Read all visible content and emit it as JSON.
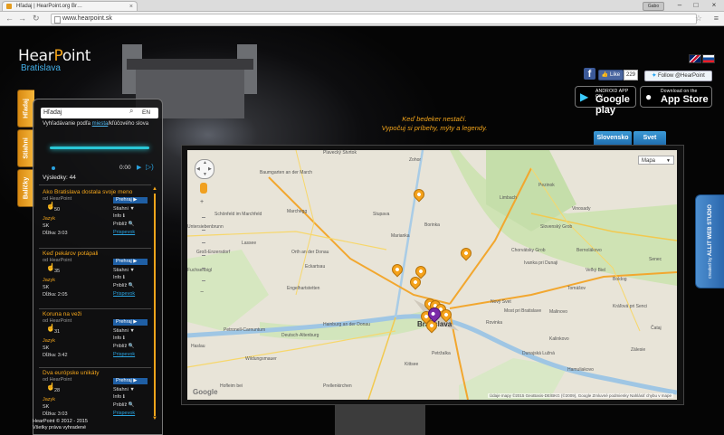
{
  "browser": {
    "tab_title": "Hľadaj | HearPoint.org Br…",
    "tab_close": "×",
    "url": "www.hearpoint.sk",
    "user_badge": "Gabo",
    "back_icon": "arrow-left-icon",
    "forward_icon": "arrow-right-icon",
    "reload_icon": "reload-icon",
    "minimize": "–",
    "maximize": "□",
    "close": "×",
    "star": "☆",
    "menu": "≡"
  },
  "brand": {
    "logo_a": "Hear",
    "logo_b": "P",
    "logo_c": "oint",
    "subtitle": "Bratislava"
  },
  "flags": [
    "en-flag-icon",
    "sk-flag-icon"
  ],
  "social": {
    "fb_icon": "f",
    "like_label": "👍 Like",
    "like_count": "229",
    "twitter_label": "Follow @HearPoint"
  },
  "stores": {
    "google_small": "ANDROID APP ON",
    "google_big": "Google play",
    "google_icon": "▶",
    "apple_small": "Download on the",
    "apple_big": "App Store",
    "apple_icon": ""
  },
  "tagline": {
    "line1": "Keď bedeker nestačí.",
    "line2": "Vypočuj si príbehy, mýty a legendy."
  },
  "map_tabs": [
    "Slovensko",
    "Svet"
  ],
  "side_tabs": [
    "Hľadaj",
    "Stiahni",
    "Balíčky"
  ],
  "panel": {
    "search_value": "Hľadaj",
    "search_icon": "⌕",
    "lang": "EN",
    "hint_pre": "Vyhľadávanie podľa ",
    "hint_link": "miesta",
    "hint_post": "/kľúčového slova",
    "player_time": "0:00",
    "play_icon": "▶",
    "volume_icon": "🔊",
    "results": "Výsledky: 44",
    "scroll_up": "▲",
    "scroll_down": "▼",
    "items": [
      {
        "title": "Ako Bratislava dostala svoje meno",
        "from": "od HearPoint",
        "count": "50",
        "l1": "Jazyk",
        "l2": "SK",
        "l3": "Dĺžka: 3:03",
        "play": "Prehraj ▶",
        "r1": "Stiahni ▼",
        "r2": "Info ℹ",
        "r3": "Priblíž 🔍",
        "r4": "Prispevok"
      },
      {
        "title": "Keď pekárov potápali",
        "from": "od HearPoint",
        "count": "35",
        "l1": "Jazyk",
        "l2": "SK",
        "l3": "Dĺžka: 2:05",
        "play": "Prehraj ▶",
        "r1": "Stiahni ▼",
        "r2": "Info ℹ",
        "r3": "Priblíž 🔍",
        "r4": "Prispevok"
      },
      {
        "title": "Koruna na veži",
        "from": "od HearPoint",
        "count": "31",
        "l1": "Jazyk",
        "l2": "SK",
        "l3": "Dĺžka: 3:42",
        "play": "Prehraj ▶",
        "r1": "Stiahni ▼",
        "r2": "Info ℹ",
        "r3": "Priblíž 🔍",
        "r4": "Prispevok"
      },
      {
        "title": "Dva európske unikáty",
        "from": "od HearPoint",
        "count": "28",
        "l1": "Jazyk",
        "l2": "SK",
        "l3": "Dĺžka: 3:03",
        "play": "Prehraj ▶",
        "r1": "Stiahni ▼",
        "r2": "Info ℹ",
        "r3": "Priblíž 🔍",
        "r4": "Prispevok"
      }
    ]
  },
  "copyright": {
    "line1": "HearPoint © 2012 - 2015",
    "line2": "Všetky práva vyhradené"
  },
  "map": {
    "type_select": "Mapa",
    "type_arrow": "▼",
    "google": "Google",
    "attribution": "Údaje mapy ©2015 GeoBasis-DE/BKG (©2009), Google  Zmluvné podmienky  Nahlásiť chybu v mape",
    "zoom_in": "+",
    "zoom_out": "−",
    "city": "Bratislava",
    "labels": [
      "Zohor",
      "Plavecký Štvrtok",
      "Stupava",
      "Borinka",
      "Marianka",
      "Limbach",
      "Pezinok",
      "Slovenský Grob",
      "Vinosady",
      "Chorvátsky Grob",
      "Ivanka pri Dunaji",
      "Senec",
      "Bernolákovo",
      "Marchegg",
      "Schönfeld im Marchfeld",
      "Untersiebenbrunn",
      "Lassee",
      "Groß-Enzersdorf",
      "Orth an der Donau",
      "Eckartsau",
      "Fuchsenbigl",
      "Engelhartstetten",
      "Hainburg an der Donau",
      "Petronell-Carnuntum",
      "Kittsee",
      "Petržalka",
      "Hofleim bei",
      "Prellenkirchen",
      "Rovinka",
      "Dunajská Lužná",
      "Malinovo",
      "Tomášov",
      "Nový Svet",
      "Most pri Bratislave",
      "Kalinkovo",
      "Hamuliakovo",
      "Kráľová pri Senci",
      "Boldog",
      "Veľký Biel",
      "Čataj",
      "Zálesie",
      "Deutsch-Altenburg",
      "Wildungsmauer",
      "Haslau",
      "Baumgarten an der March"
    ]
  },
  "studio": {
    "pre": "created by ",
    "name": "ALLIT WEB STUDIO"
  },
  "colors": {
    "accent": "#f3a51b",
    "link": "#2aa3e0",
    "tab_blue": "#1e6cae",
    "pin": "#f5a21b",
    "pin_selected": "#7a2aa8"
  }
}
